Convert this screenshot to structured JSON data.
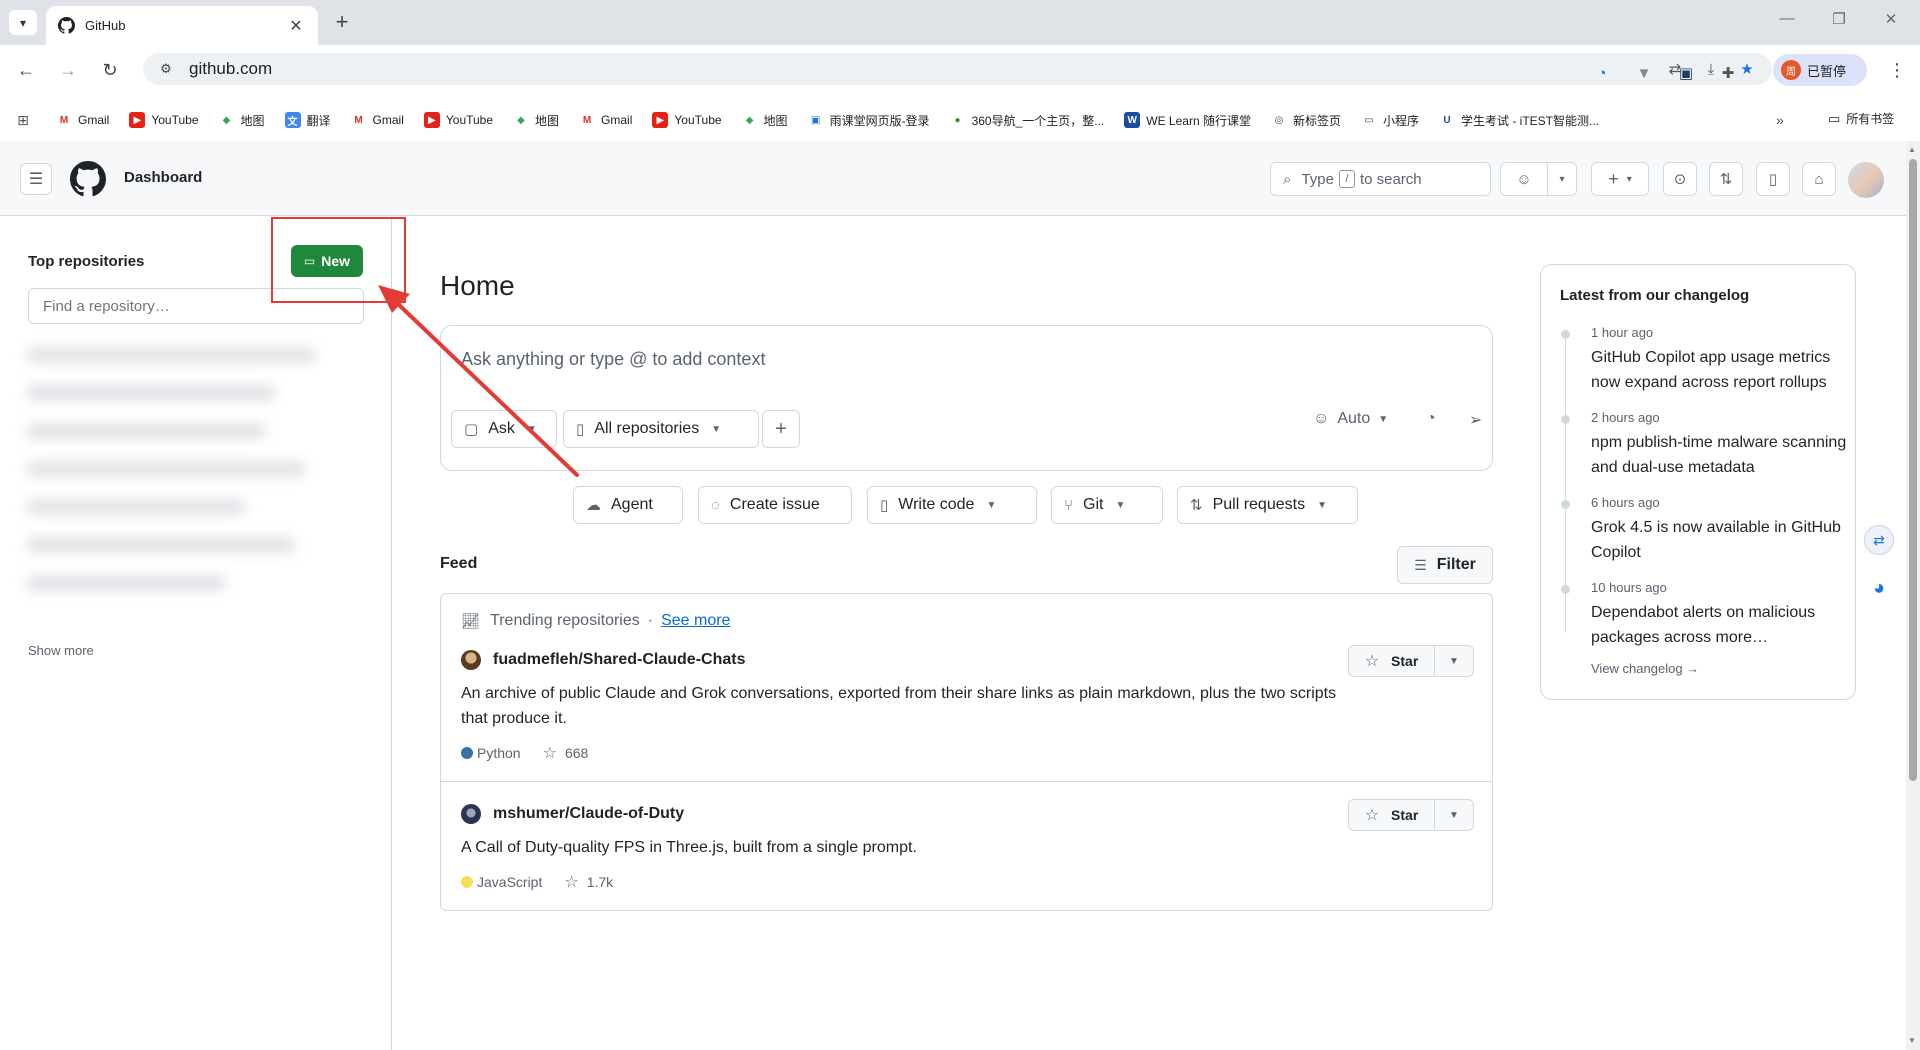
{
  "browser": {
    "tab_title": "GitHub",
    "url": "github.com",
    "paused_label": "已暂停",
    "paused_avatar": "周",
    "bookmarks": [
      {
        "label": "Gmail",
        "icon": "gmail-icon"
      },
      {
        "label": "YouTube",
        "icon": "youtube-icon"
      },
      {
        "label": "地图",
        "icon": "maps-icon"
      },
      {
        "label": "翻译",
        "icon": "translate-icon"
      },
      {
        "label": "Gmail",
        "icon": "gmail-icon"
      },
      {
        "label": "YouTube",
        "icon": "youtube-icon"
      },
      {
        "label": "地图",
        "icon": "maps-icon"
      },
      {
        "label": "Gmail",
        "icon": "gmail-icon"
      },
      {
        "label": "YouTube",
        "icon": "youtube-icon"
      },
      {
        "label": "地图",
        "icon": "maps-icon"
      },
      {
        "label": "雨课堂网页版-登录",
        "icon": "rain-classroom-icon"
      },
      {
        "label": "360导航_一个主页，整...",
        "icon": "360-icon"
      },
      {
        "label": "WE Learn 随行课堂",
        "icon": "welearn-icon"
      },
      {
        "label": "新标签页",
        "icon": "chrome-icon"
      },
      {
        "label": "小程序",
        "icon": "folder-icon"
      },
      {
        "label": "学生考试 - iTEST智能测...",
        "icon": "itest-icon"
      }
    ],
    "all_bookmarks": "所有书签"
  },
  "header": {
    "title": "Dashboard",
    "search_prefix": "Type",
    "search_key": "/",
    "search_suffix": "to search"
  },
  "sidebar": {
    "heading": "Top repositories",
    "new_label": "New",
    "find_placeholder": "Find a repository…",
    "show_more": "Show more"
  },
  "main": {
    "title": "Home",
    "ask_placeholder": "Ask anything or type @ to add context",
    "ask_button": "Ask",
    "repo_scope": "All repositories",
    "model": "Auto",
    "actions": [
      "Agent",
      "Create issue",
      "Write code",
      "Git",
      "Pull requests"
    ],
    "feed_label": "Feed",
    "filter_label": "Filter",
    "trending_label": "Trending repositories",
    "see_more": "See more",
    "star_label": "Star",
    "repos": [
      {
        "name": "fuadmefleh/Shared-Claude-Chats",
        "description": "An archive of public Claude and Grok conversations, exported from their share links as plain markdown, plus the two scripts that produce it.",
        "language": "Python",
        "language_color": "#3572A5",
        "stars": "668"
      },
      {
        "name": "mshumer/Claude-of-Duty",
        "description": "A Call of Duty-quality FPS in Three.js, built from a single prompt.",
        "language": "JavaScript",
        "language_color": "#f1e05a",
        "stars": "1.7k"
      }
    ]
  },
  "changelog": {
    "title": "Latest from our changelog",
    "entries": [
      {
        "time": "1 hour ago",
        "text": "GitHub Copilot app usage metrics now expand across report rollups"
      },
      {
        "time": "2 hours ago",
        "text": "npm publish-time malware scanning and dual-use metadata"
      },
      {
        "time": "6 hours ago",
        "text": "Grok 4.5 is now available in GitHub Copilot"
      },
      {
        "time": "10 hours ago",
        "text": "Dependabot alerts on malicious packages across more…"
      }
    ],
    "view_link": "View changelog →"
  },
  "colors": {
    "primary_green": "#1f883d",
    "annotation_red": "#e43b35",
    "link_blue": "#0969da"
  }
}
